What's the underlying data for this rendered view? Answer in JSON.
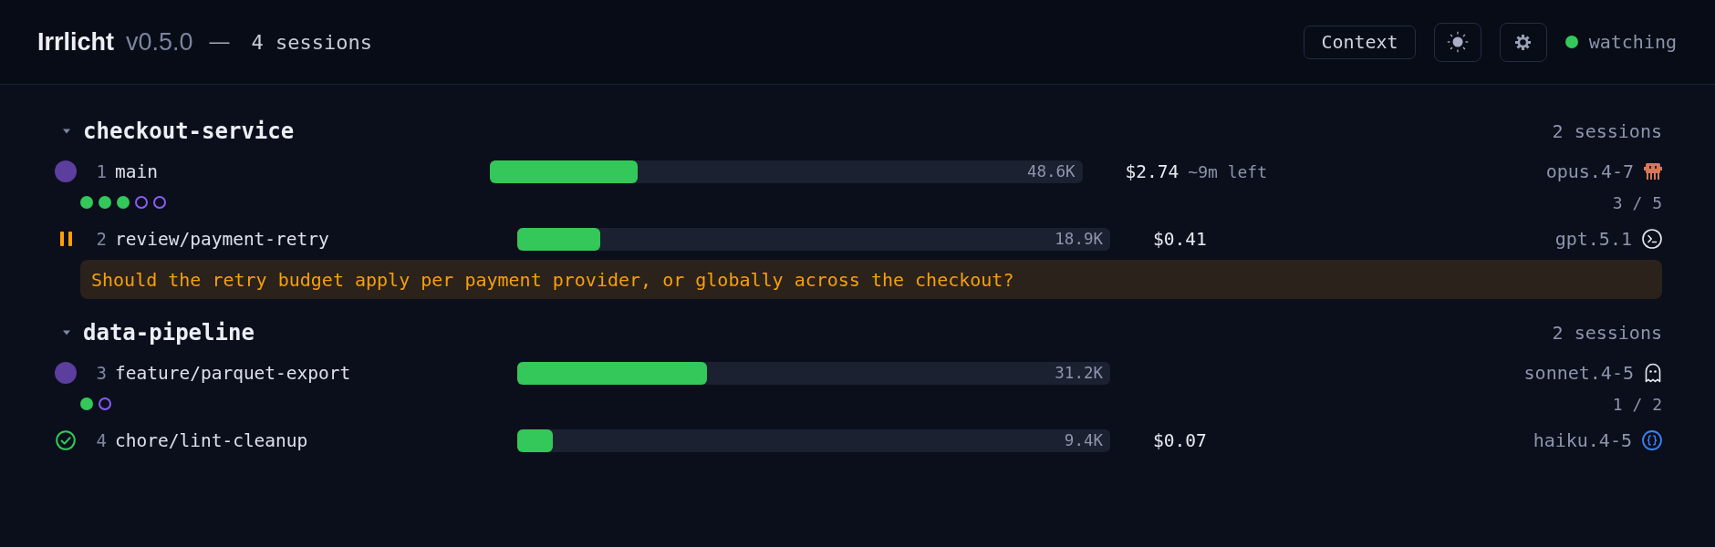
{
  "header": {
    "app_name": "Irrlicht",
    "version": "v0.5.0",
    "separator": "—",
    "session_count": "4 sessions",
    "context_button": "Context",
    "watcher": {
      "label": "watching",
      "active": true
    }
  },
  "groups": [
    {
      "name": "checkout-service",
      "expanded": true,
      "session_count": "2 sessions",
      "sessions": [
        {
          "number": "1",
          "branch": "main",
          "kind": "working",
          "level": 0.25,
          "tokens": "48.6K",
          "cost": "$2.74",
          "time_left": "~9m left",
          "model": {
            "name": "opus.4-7",
            "kind": "crab"
          },
          "steps": [
            {
              "done": true
            },
            {
              "done": true
            },
            {
              "done": true
            },
            {
              "done": false
            },
            {
              "done": false
            }
          ],
          "progress": "3 / 5"
        },
        {
          "number": "2",
          "branch": "review/payment-retry",
          "kind": "waiting",
          "level": 0.14,
          "tokens": "18.9K",
          "cost": "$0.41",
          "model": {
            "name": "gpt.5.1",
            "kind": "terminal"
          },
          "question": "Should the retry budget apply per payment provider, or globally across the checkout?"
        }
      ]
    },
    {
      "name": "data-pipeline",
      "expanded": true,
      "session_count": "2 sessions",
      "sessions": [
        {
          "number": "3",
          "branch": "feature/parquet-export",
          "kind": "working",
          "level": 0.32,
          "tokens": "31.2K",
          "model": {
            "name": "sonnet.4-5",
            "kind": "ghost"
          },
          "steps": [
            {
              "done": true
            },
            {
              "done": false
            }
          ],
          "progress": "1 / 2"
        },
        {
          "number": "4",
          "branch": "chore/lint-cleanup",
          "kind": "done",
          "level": 0.06,
          "tokens": "9.4K",
          "cost": "$0.07",
          "model": {
            "name": "haiku.4-5",
            "kind": "braces"
          }
        }
      ]
    }
  ]
}
